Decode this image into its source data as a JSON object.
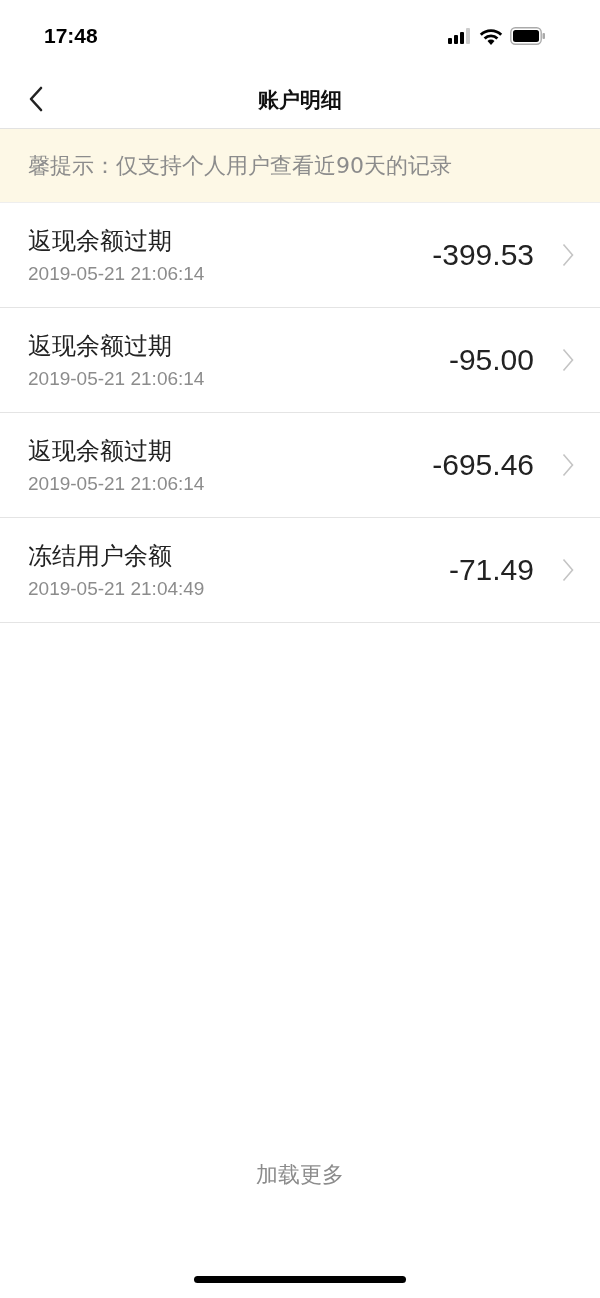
{
  "status_bar": {
    "time": "17:48"
  },
  "nav": {
    "title": "账户明细"
  },
  "notice": {
    "text": "馨提示：仅支持个人用户查看近90天的记录"
  },
  "records": [
    {
      "title": "返现余额过期",
      "time": "2019-05-21 21:06:14",
      "amount": "-399.53"
    },
    {
      "title": "返现余额过期",
      "time": "2019-05-21 21:06:14",
      "amount": "-95.00"
    },
    {
      "title": "返现余额过期",
      "time": "2019-05-21 21:06:14",
      "amount": "-695.46"
    },
    {
      "title": "冻结用户余额",
      "time": "2019-05-21 21:04:49",
      "amount": "-71.49"
    }
  ],
  "load_more": {
    "label": "加载更多"
  }
}
